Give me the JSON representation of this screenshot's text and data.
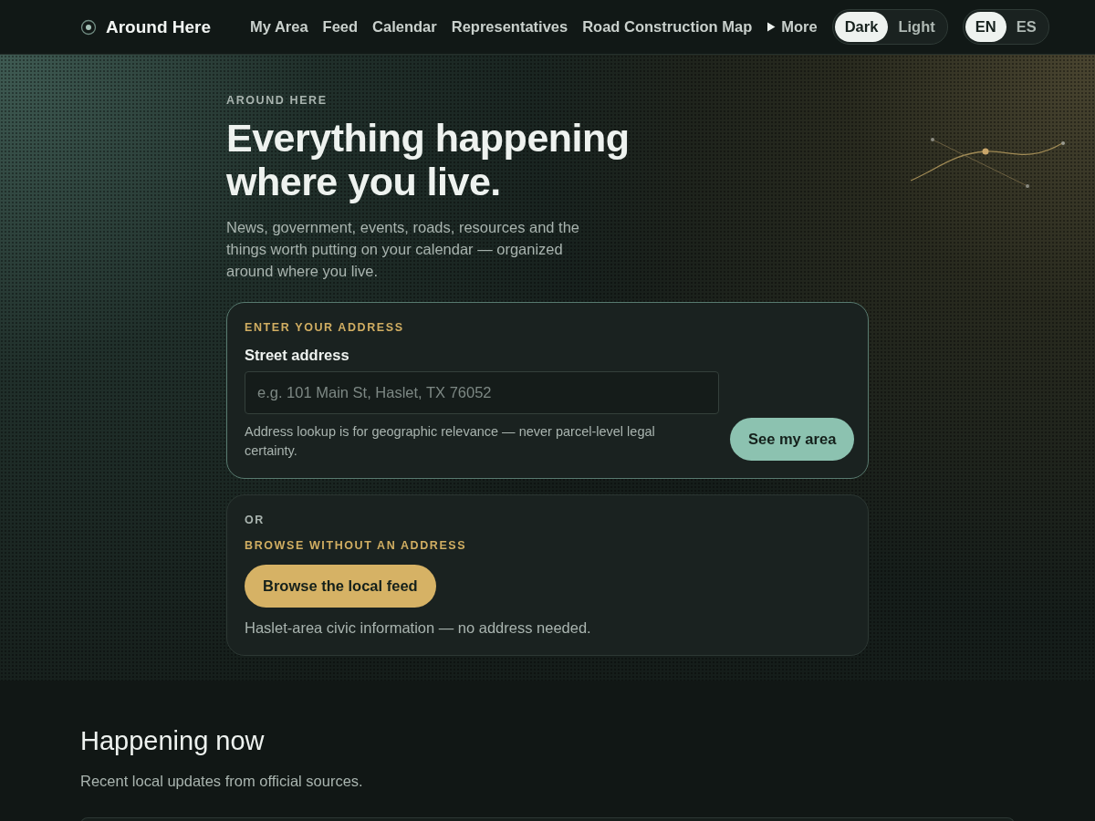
{
  "nav": {
    "brand": "Around Here",
    "links": [
      {
        "label": "My Area"
      },
      {
        "label": "Feed"
      },
      {
        "label": "Calendar"
      },
      {
        "label": "Representatives"
      },
      {
        "label": "Road Construction Map"
      }
    ],
    "more": {
      "label": "More",
      "expanded": false
    },
    "theme": [
      {
        "label": "Dark",
        "selected": true
      },
      {
        "label": "Light",
        "selected": false
      }
    ],
    "language": [
      {
        "label": "EN",
        "selected": true
      },
      {
        "label": "ES",
        "selected": false
      }
    ]
  },
  "hero": {
    "eyebrow": "AROUND HERE",
    "title_lines": [
      "Everything happening",
      "where you live."
    ],
    "lede": "News, government, events, roads, resources and the things worth putting on your calendar — organized around where you live."
  },
  "address_card": {
    "eyebrow": "ENTER YOUR ADDRESS",
    "label": "Street address",
    "placeholder": "e.g. 101 Main St, Haslet, TX 76052",
    "note": "Address lookup is for geographic relevance — never parcel-level legal certainty.",
    "button": "See my area"
  },
  "browse_card": {
    "or": "OR",
    "eyebrow": "BROWSE WITHOUT AN ADDRESS",
    "button": "Browse the local feed",
    "note": "Haslet-area civic information — no address needed."
  },
  "happening": {
    "title": "Happening now",
    "subtitle": "Recent local updates from official sources."
  }
}
